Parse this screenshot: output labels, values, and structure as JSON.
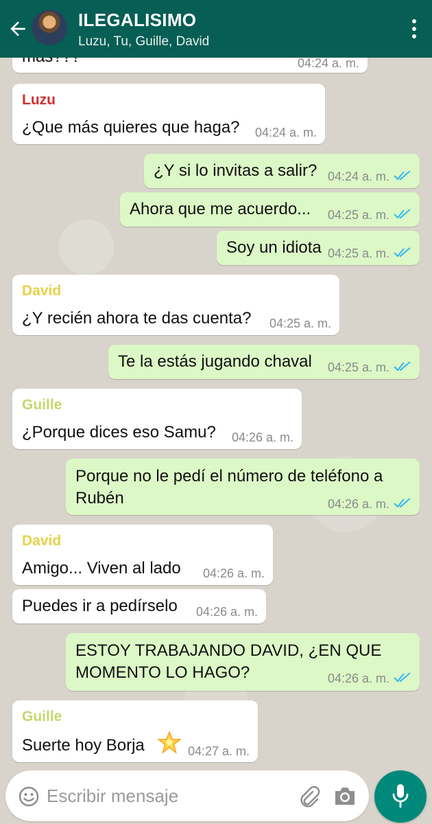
{
  "header": {
    "title": "ILEGALISIMO",
    "participants": "Luzu, Tu, Guille, David"
  },
  "colors": {
    "header": "#075e54",
    "incoming_bubble": "#ffffff",
    "outgoing_bubble": "#dcf8c6",
    "read_ticks": "#34b7f1",
    "luzu": "#d32f2f",
    "david": "#e8d14a",
    "guille": "#c5d86d",
    "mic_button": "#00897b"
  },
  "messages": [
    {
      "type": "in",
      "text": "mas???",
      "time": "04:24 a. m."
    },
    {
      "type": "in",
      "sender": "Luzu",
      "text": "¿Que más quieres que haga?",
      "time": "04:24 a. m."
    },
    {
      "type": "out",
      "text": "¿Y si lo invitas a salir?",
      "time": "04:24 a. m.",
      "status": "read"
    },
    {
      "type": "out",
      "text": "Ahora que me acuerdo...",
      "time": "04:25 a. m.",
      "status": "read"
    },
    {
      "type": "out",
      "text": "Soy un idiota",
      "time": "04:25 a. m.",
      "status": "read"
    },
    {
      "type": "in",
      "sender": "David",
      "text": "¿Y recién ahora te das cuenta?",
      "time": "04:25 a. m."
    },
    {
      "type": "out",
      "text": "Te la estás jugando chaval",
      "time": "04:25 a. m.",
      "status": "read"
    },
    {
      "type": "in",
      "sender": "Guille",
      "text": "¿Porque dices eso Samu?",
      "time": "04:26 a. m."
    },
    {
      "type": "out",
      "text": [
        "Porque no le pedí el número de teléfono a",
        "Rubén"
      ],
      "time": "04:26 a. m.",
      "status": "read"
    },
    {
      "type": "in",
      "sender": "David",
      "text": "Amigo... Viven al lado",
      "time": "04:26 a. m."
    },
    {
      "type": "in",
      "text": "Puedes ir a pedírselo",
      "time": "04:26 a. m."
    },
    {
      "type": "out",
      "text": [
        "ESTOY TRABAJANDO DAVID, ¿EN QUE",
        "MOMENTO LO HAGO?"
      ],
      "time": "04:26 a. m.",
      "status": "read"
    },
    {
      "type": "in",
      "sender": "Guille",
      "text": "Suerte hoy Borja",
      "emoji": "star-emoji",
      "time": "04:27 a. m."
    }
  ],
  "composer": {
    "placeholder": "Escribir mensaje",
    "icons": [
      "emoji-icon",
      "attach-icon",
      "camera-icon",
      "mic-icon"
    ]
  }
}
